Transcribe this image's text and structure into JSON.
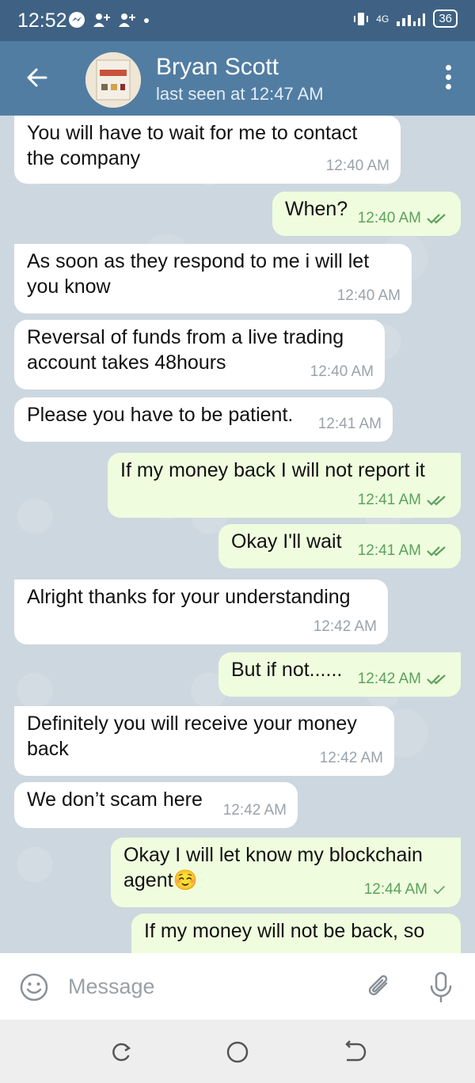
{
  "status_bar": {
    "time": "12:52",
    "network": "4G",
    "battery": "36",
    "icons": [
      "messenger-icon",
      "add-user-icon",
      "add-user-icon",
      "dot-icon"
    ]
  },
  "header": {
    "contact_name": "Bryan Scott",
    "last_seen": "last seen at 12:47 AM",
    "avatar_text": "THE BITCOIN STANDARD"
  },
  "messages": [
    {
      "dir": "in",
      "lines": [
        "You will have to wait for me to contact",
        "the company"
      ],
      "time": "12:40 AM"
    },
    {
      "dir": "out",
      "lines": [
        "When?"
      ],
      "time": "12:40 AM",
      "status": "read"
    },
    {
      "dir": "in",
      "lines": [
        "As soon as they respond to me i will let",
        "you know"
      ],
      "time": "12:40 AM"
    },
    {
      "dir": "in",
      "lines": [
        "Reversal of funds from a live trading",
        "account takes 48hours"
      ],
      "time": "12:40 AM"
    },
    {
      "dir": "in",
      "lines": [
        "Please you have to be patient."
      ],
      "time": "12:41 AM"
    },
    {
      "dir": "out",
      "lines": [
        "If my money back I will not report it"
      ],
      "time": "12:41 AM",
      "status": "read"
    },
    {
      "dir": "out",
      "lines": [
        "Okay I'll wait"
      ],
      "time": "12:41 AM",
      "status": "read"
    },
    {
      "dir": "in",
      "lines": [
        "Alright thanks for your understanding"
      ],
      "time": "12:42 AM"
    },
    {
      "dir": "out",
      "lines": [
        "But if not......"
      ],
      "time": "12:42 AM",
      "status": "read"
    },
    {
      "dir": "in",
      "lines": [
        "Definitely you will receive your money",
        "back"
      ],
      "time": "12:42 AM"
    },
    {
      "dir": "in",
      "lines": [
        "We don’t scam here"
      ],
      "time": "12:42 AM"
    },
    {
      "dir": "out",
      "lines": [
        "Okay I will let know my blockchain",
        "agent☺️"
      ],
      "time": "12:44 AM",
      "status": "sent"
    },
    {
      "dir": "out",
      "lines": [
        "If my money will not be back, so"
      ],
      "time": "",
      "status": ""
    }
  ],
  "input": {
    "placeholder": "Message",
    "value": ""
  },
  "colors": {
    "status_bar": "#3f6284",
    "header": "#517da2",
    "incoming_bubble": "#ffffff",
    "outgoing_bubble": "#effdde",
    "check_color": "#5aa25c",
    "chat_background": "#cdd7df"
  }
}
